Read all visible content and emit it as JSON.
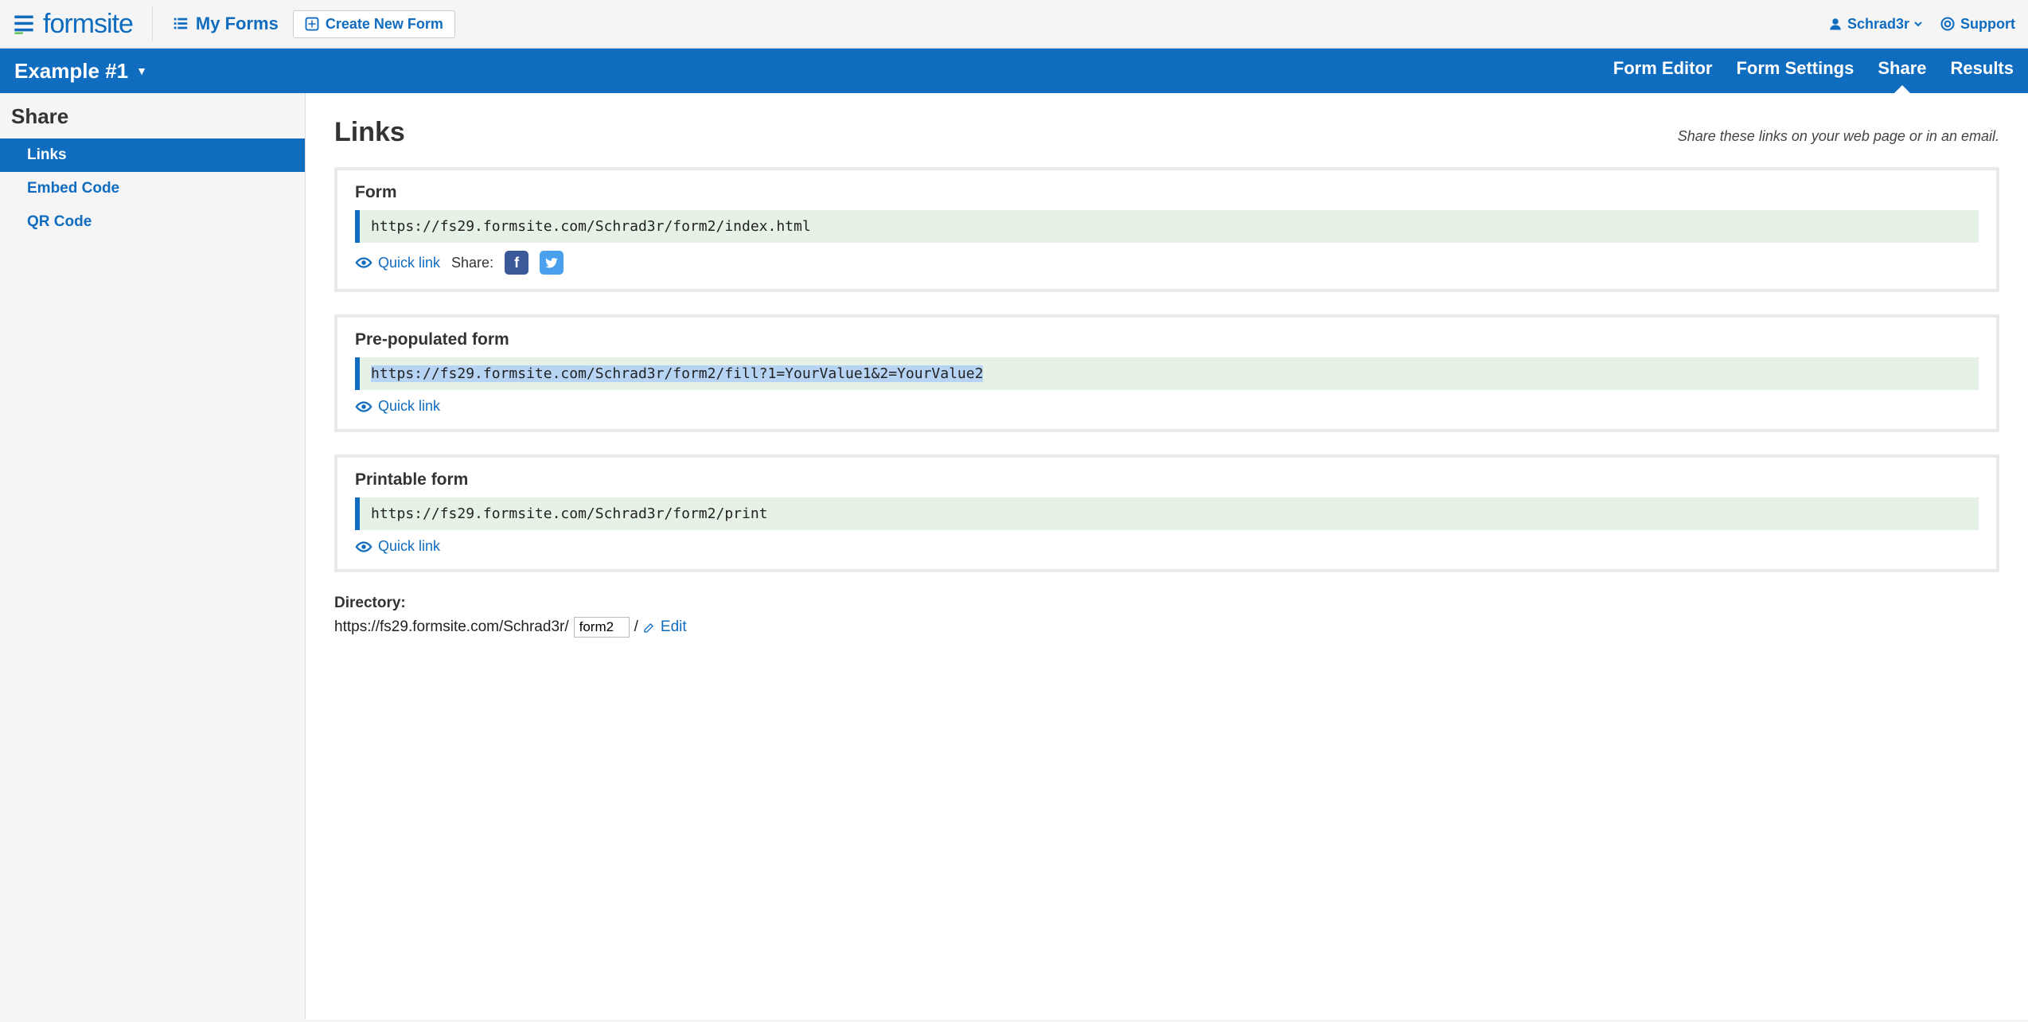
{
  "brand": "formsite",
  "header": {
    "my_forms": "My Forms",
    "create_new": "Create New Form",
    "username": "Schrad3r",
    "support": "Support"
  },
  "bluebar": {
    "form_name": "Example #1",
    "nav": {
      "editor": "Form Editor",
      "settings": "Form Settings",
      "share": "Share",
      "results": "Results"
    }
  },
  "sidebar": {
    "title": "Share",
    "items": {
      "links": "Links",
      "embed": "Embed Code",
      "qr": "QR Code"
    }
  },
  "page": {
    "title": "Links",
    "hint": "Share these links on your web page or in an email."
  },
  "cards": {
    "form": {
      "heading": "Form",
      "url": "https://fs29.formsite.com/Schrad3r/form2/index.html",
      "quick": "Quick link",
      "share_label": "Share:"
    },
    "prepop": {
      "heading": "Pre-populated form",
      "url": "https://fs29.formsite.com/Schrad3r/form2/fill?1=YourValue1&2=YourValue2",
      "quick": "Quick link"
    },
    "print": {
      "heading": "Printable form",
      "url": "https://fs29.formsite.com/Schrad3r/form2/print",
      "quick": "Quick link"
    }
  },
  "directory": {
    "label": "Directory:",
    "base": "https://fs29.formsite.com/Schrad3r/",
    "value": "form2",
    "slash": "/",
    "edit": "Edit"
  }
}
